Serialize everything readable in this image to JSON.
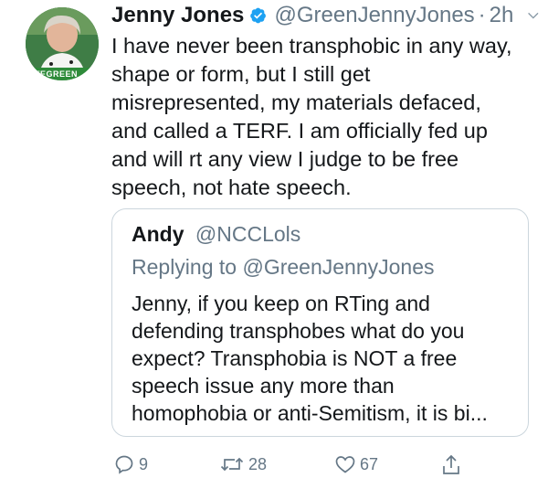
{
  "tweet": {
    "author": {
      "display_name": "Jenny Jones",
      "handle": "@GreenJennyJones",
      "separator": "·",
      "time": "2h",
      "avatar_banner_text": "TEGREEN"
    },
    "text_lines": [
      "I have never been transphobic in any way,",
      "shape or form, but I still get",
      "misrepresented, my materials defaced,",
      "and called a TERF. I am officially fed up",
      "and will rt any view I judge to be free",
      "speech, not hate speech."
    ],
    "quoted": {
      "display_name": "Andy",
      "handle": "@NCCLols",
      "replying_prefix": "Replying to",
      "replying_to": "@GreenJennyJones",
      "text_lines": [
        "Jenny, if you keep on RTing and",
        "defending transphobes what do you",
        "expect? Transphobia is NOT a free",
        "speech issue any more than",
        "homophobia or anti-Semitism, it is bi..."
      ]
    },
    "actions": {
      "reply_count": "9",
      "retweet_count": "28",
      "like_count": "67"
    }
  },
  "colors": {
    "text": "#14171a",
    "secondary": "#657786",
    "verified_blue": "#1da1f2",
    "border": "#ccd6dd",
    "avatar_green": "#2f8a3e"
  },
  "icons": {
    "verified": "verified-badge-icon",
    "caret": "chevron-down-icon",
    "reply": "reply-icon",
    "retweet": "retweet-icon",
    "like": "heart-icon",
    "share": "share-icon"
  }
}
